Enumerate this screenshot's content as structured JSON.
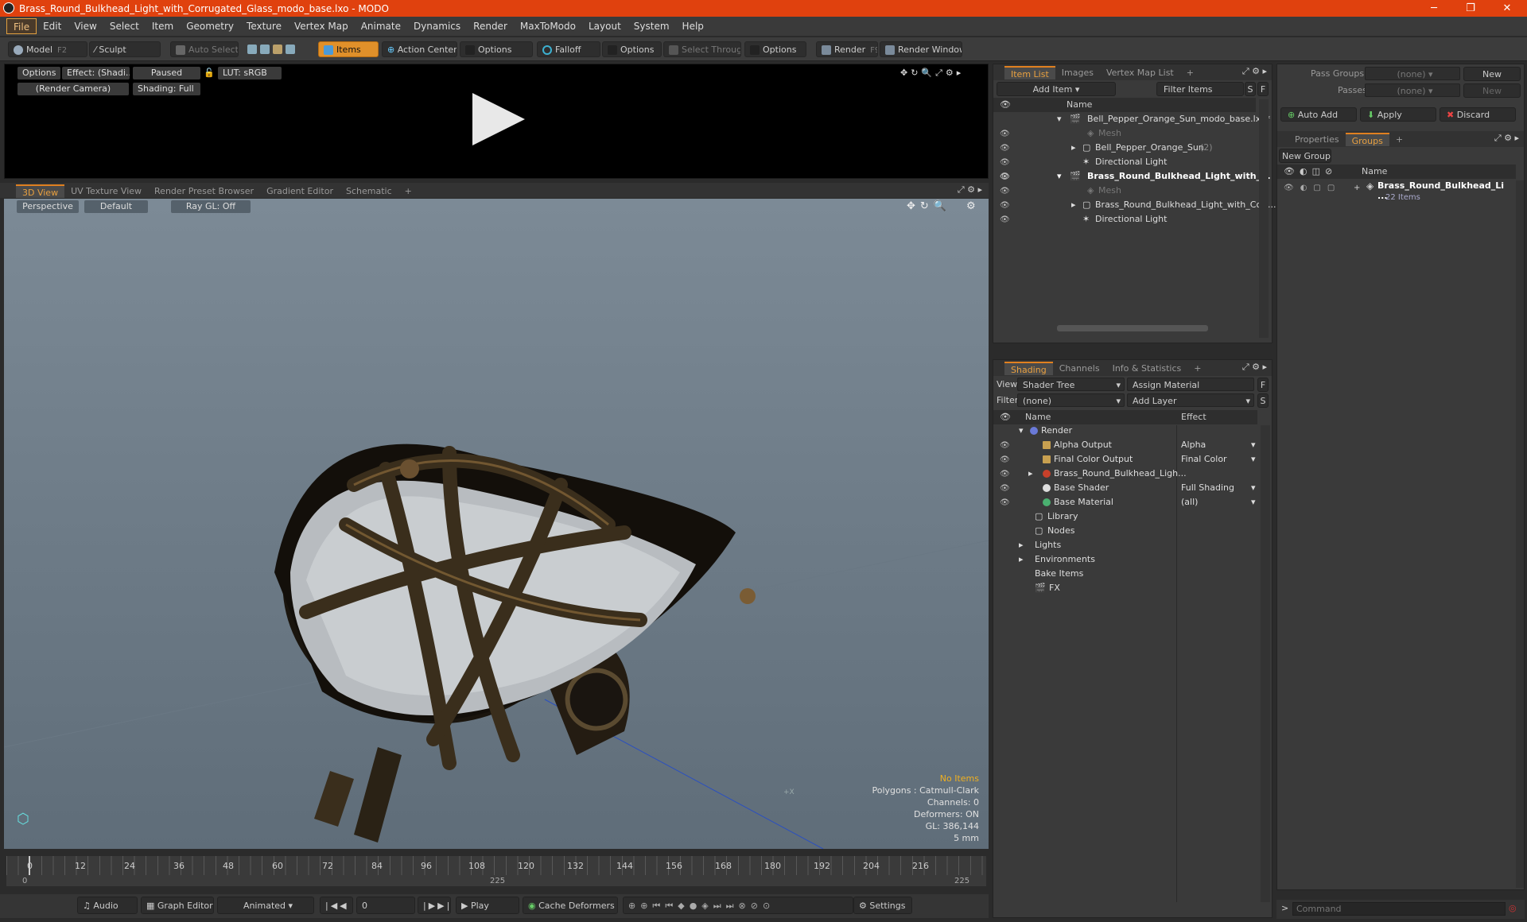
{
  "window": {
    "title": "Brass_Round_Bulkhead_Light_with_Corrugated_Glass_modo_base.lxo - MODO",
    "minimize": "─",
    "maximize": "❐",
    "close": "✕"
  },
  "menu": [
    "File",
    "Edit",
    "View",
    "Select",
    "Item",
    "Geometry",
    "Texture",
    "Vertex Map",
    "Animate",
    "Dynamics",
    "Render",
    "MaxToModo",
    "Layout",
    "System",
    "Help"
  ],
  "toolbar": {
    "model": "Model",
    "model_key": "F2",
    "sculpt": "Sculpt",
    "auto_select": "Auto Select",
    "items": "Items",
    "action_center": "Action Center",
    "options1": "Options",
    "falloff": "Falloff",
    "options2": "Options",
    "select_through": "Select Through",
    "options3": "Options",
    "render": "Render",
    "render_key": "F9",
    "render_window": "Render Window"
  },
  "preview": {
    "options": "Options",
    "effect": "Effect: (Shadi...",
    "paused": "Paused",
    "lut": "LUT: sRGB",
    "camera": "(Render Camera)",
    "shading": "Shading: Full"
  },
  "viewport_tabs": [
    "3D View",
    "UV Texture View",
    "Render Preset Browser",
    "Gradient Editor",
    "Schematic",
    "+"
  ],
  "viewport": {
    "perspective": "Perspective",
    "default": "Default",
    "raygl": "Ray GL: Off",
    "no_items": "No Items",
    "polygons": "Polygons : Catmull-Clark",
    "channels": "Channels: 0",
    "deformers": "Deformers: ON",
    "gl": "GL: 386,144",
    "scale": "5 mm",
    "axis_x": "+X"
  },
  "timeline": {
    "ticks": [
      "0",
      "12",
      "24",
      "36",
      "48",
      "60",
      "72",
      "84",
      "96",
      "108",
      "120",
      "132",
      "144",
      "156",
      "168",
      "180",
      "192",
      "204",
      "216"
    ],
    "start": "0",
    "mid": "225",
    "end": "225"
  },
  "transport": {
    "audio": "Audio",
    "graph_editor": "Graph Editor",
    "animated": "Animated",
    "frame": "0",
    "play": "Play",
    "cache": "Cache Deformers",
    "settings": "Settings"
  },
  "item_list": {
    "tabs": [
      "Item List",
      "Images",
      "Vertex Map List",
      "+"
    ],
    "add_item": "Add Item",
    "filter": "Filter Items",
    "s": "S",
    "f": "F",
    "name_col": "Name",
    "rows": [
      {
        "label": "Bell_Pepper_Orange_Sun_modo_base.lxo*",
        "extra": ""
      },
      {
        "label": "Mesh",
        "extra": ""
      },
      {
        "label": "Bell_Pepper_Orange_Sun",
        "extra": "(2)"
      },
      {
        "label": "Directional Light",
        "extra": ""
      },
      {
        "label": "Brass_Round_Bulkhead_Light_with_...",
        "extra": ""
      },
      {
        "label": "Mesh",
        "extra": ""
      },
      {
        "label": "Brass_Round_Bulkhead_Light_with_Corr...",
        "extra": ""
      },
      {
        "label": "Directional Light",
        "extra": ""
      }
    ]
  },
  "shading": {
    "tabs": [
      "Shading",
      "Channels",
      "Info & Statistics",
      "+"
    ],
    "view_label": "View",
    "view_value": "Shader Tree",
    "assign": "Assign Material",
    "f": "F",
    "filter_label": "Filter",
    "filter_value": "(none)",
    "add_layer": "Add Layer",
    "s": "S",
    "name_col": "Name",
    "effect_col": "Effect",
    "rows": [
      {
        "name": "Render",
        "effect": ""
      },
      {
        "name": "Alpha Output",
        "effect": "Alpha"
      },
      {
        "name": "Final Color Output",
        "effect": "Final Color"
      },
      {
        "name": "Brass_Round_Bulkhead_Ligh...",
        "effect": ""
      },
      {
        "name": "Base Shader",
        "effect": "Full Shading"
      },
      {
        "name": "Base Material",
        "effect": "(all)"
      },
      {
        "name": "Library",
        "effect": ""
      },
      {
        "name": "Nodes",
        "effect": ""
      },
      {
        "name": "Lights",
        "effect": ""
      },
      {
        "name": "Environments",
        "effect": ""
      },
      {
        "name": "Bake Items",
        "effect": ""
      },
      {
        "name": "FX",
        "effect": ""
      }
    ]
  },
  "groups": {
    "pass_groups": "Pass Groups",
    "pass_groups_val": "(none)",
    "new1": "New",
    "passes": "Passes",
    "passes_val": "(none)",
    "new2": "New",
    "auto_add": "Auto Add",
    "apply": "Apply",
    "discard": "Discard",
    "tabs": [
      "Properties",
      "Groups",
      "+"
    ],
    "new_group": "New Group",
    "name_col": "Name",
    "item": "Brass_Round_Bulkhead_Li ...",
    "count": "22 Items"
  },
  "command": {
    "placeholder": "Command"
  }
}
